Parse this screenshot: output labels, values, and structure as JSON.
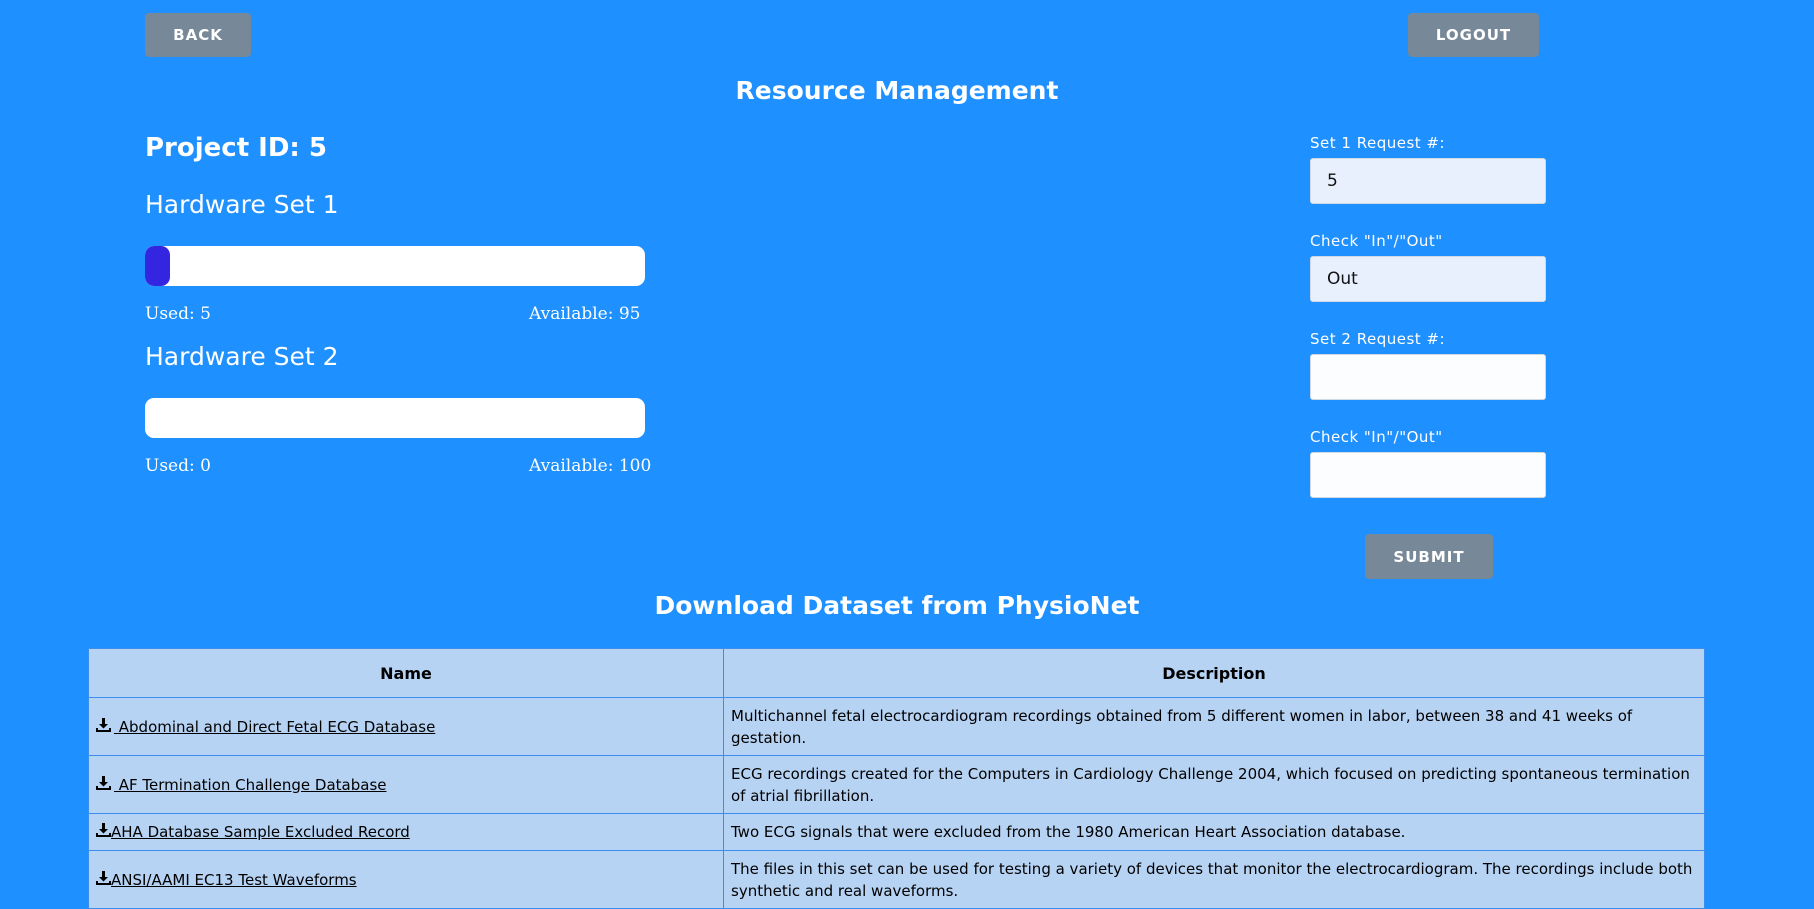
{
  "header": {
    "back_label": "BACK",
    "logout_label": "LOGOUT",
    "title": "Resource Management"
  },
  "project": {
    "id_text": "Project ID: 5"
  },
  "hardware_sets": [
    {
      "title": "Hardware Set 1",
      "used_text": "Used: 5",
      "available_text": "Available: 95",
      "used_fraction": 0.05
    },
    {
      "title": "Hardware Set 2",
      "used_text": "Used: 0",
      "available_text": "Available: 100",
      "used_fraction": 0.0
    }
  ],
  "form": {
    "set1_label": "Set 1 Request #:",
    "set1_value": "5",
    "check1_label": "Check \"In\"/\"Out\"",
    "check1_value": "Out",
    "set2_label": "Set 2 Request #:",
    "set2_value": "",
    "check2_label": "Check \"In\"/\"Out\"",
    "check2_value": "",
    "submit_label": "SUBMIT"
  },
  "datasets": {
    "title": "Download Dataset from PhysioNet",
    "columns": [
      "Name",
      "Description"
    ],
    "rows": [
      {
        "name": " Abdominal and Direct Fetal ECG Database",
        "description": "Multichannel fetal electrocardiogram recordings obtained from 5 different women in labor, between 38 and 41 weeks of gestation."
      },
      {
        "name": " AF Termination Challenge Database",
        "description": "ECG recordings created for the Computers in Cardiology Challenge 2004, which focused on predicting spontaneous termination of atrial fibrillation."
      },
      {
        "name": "AHA Database Sample Excluded Record",
        "description": "Two ECG signals that were excluded from the 1980 American Heart Association database."
      },
      {
        "name": "ANSI/AAMI EC13 Test Waveforms",
        "description": "The files in this set can be used for testing a variety of devices that monitor the electrocardiogram. The recordings include both synthetic and real waveforms."
      }
    ]
  },
  "colors": {
    "background": "#1e90ff",
    "button": "#778899",
    "bar_fill": "#3325e0",
    "table_bg": "#b7d3f4"
  }
}
